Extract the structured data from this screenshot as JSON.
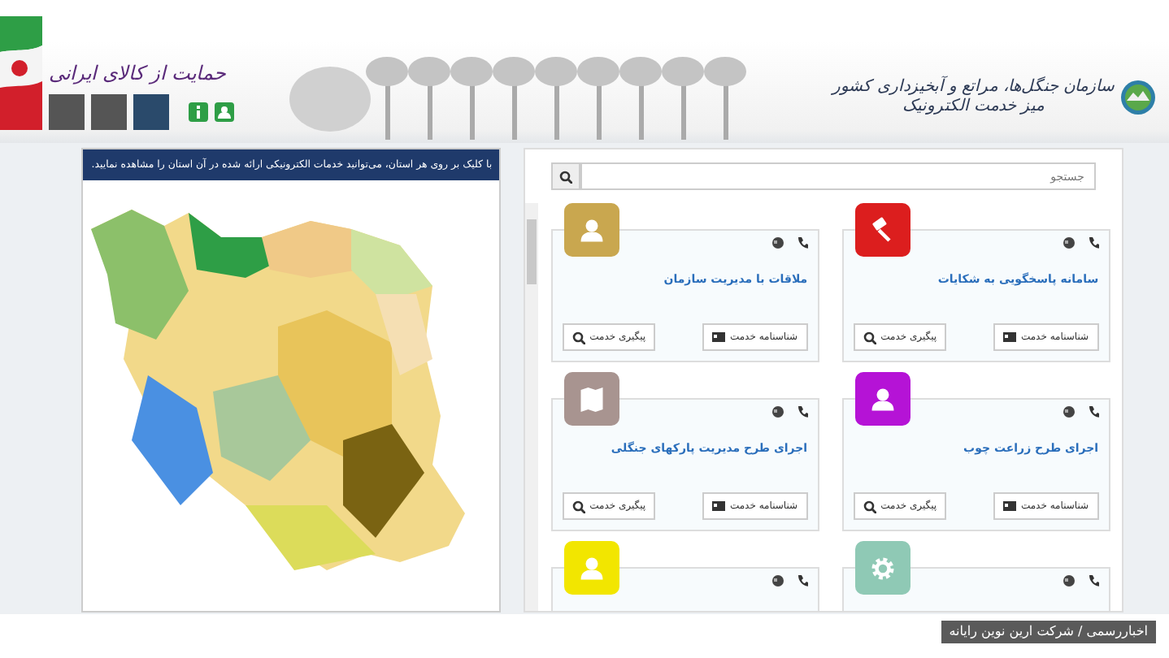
{
  "header": {
    "org_name": "سازمان جنگل‌ها، مراتع و آبخیزداری کشور",
    "subtitle": "میز خدمت الکترونیک",
    "slogan": "حمایت از کالای ایرانی"
  },
  "map_panel": {
    "notice": "با کلیک بر روی هر استان، می‌توانید خدمات الکترونیکی ارائه شده در آن استان را مشاهده نمایید."
  },
  "search": {
    "placeholder": "جستجو"
  },
  "services": [
    {
      "title": "سامانه پاسخگویی به شکایات",
      "color": "#dc1e1e",
      "kind": "gavel",
      "buttons": [
        "شناسنامه خدمت",
        "پیگیری خدمت"
      ]
    },
    {
      "title": "ملاقات با مدیریت سازمان",
      "color": "#c9a74f",
      "kind": "user",
      "buttons": [
        "شناسنامه خدمت",
        "پیگیری خدمت"
      ]
    },
    {
      "title": "اجرای طرح زراعت چوب",
      "color": "#b513d6",
      "kind": "user",
      "buttons": [
        "شناسنامه خدمت",
        "پیگیری خدمت"
      ]
    },
    {
      "title": "اجرای طرح مدیریت پارکهای جنگلی",
      "color": "#a89490",
      "kind": "map",
      "buttons": [
        "شناسنامه خدمت",
        "پیگیری خدمت"
      ]
    },
    {
      "color": "#8fc9b5",
      "kind": "gear"
    },
    {
      "color": "#f2e600",
      "kind": "user"
    }
  ],
  "footer": {
    "credit": "اخباررسمی / شرکت ارین نوین رایانه"
  }
}
